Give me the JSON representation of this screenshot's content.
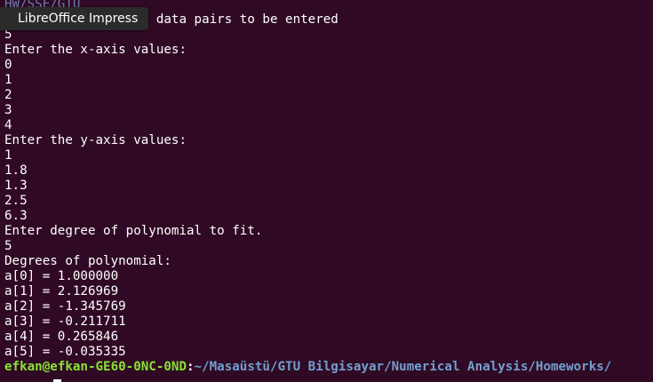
{
  "tooltip": {
    "label": "LibreOffice Impress"
  },
  "terminal": {
    "top_partial": "HW/SSE/GTU",
    "lines": [
      "Enter the number of data pairs to be entered",
      "5",
      "Enter the x-axis values:",
      "0",
      "1",
      "2",
      "3",
      "4",
      "Enter the y-axis values:",
      "1",
      "1.8",
      "1.3",
      "2.5",
      "6.3",
      "Enter degree of polynomial to fit.",
      "5",
      "Degrees of polynomial:",
      "a[0] = 1.000000",
      "a[1] = 2.126969",
      "a[2] = -1.345769",
      "a[3] = -0.211711",
      "a[4] = 0.265846",
      "a[5] = -0.035335"
    ],
    "prompt": {
      "user_host": "efkan@efkan-GE60-0NC-0ND",
      "separator": ":",
      "path": "~/Masaüstü/GTU Bilgisayar/Numerical Analysis/Homeworks/"
    }
  },
  "colors": {
    "background": "#300a24",
    "text": "#ffffff",
    "prompt_user": "#8ae234",
    "prompt_path": "#729fcf"
  }
}
